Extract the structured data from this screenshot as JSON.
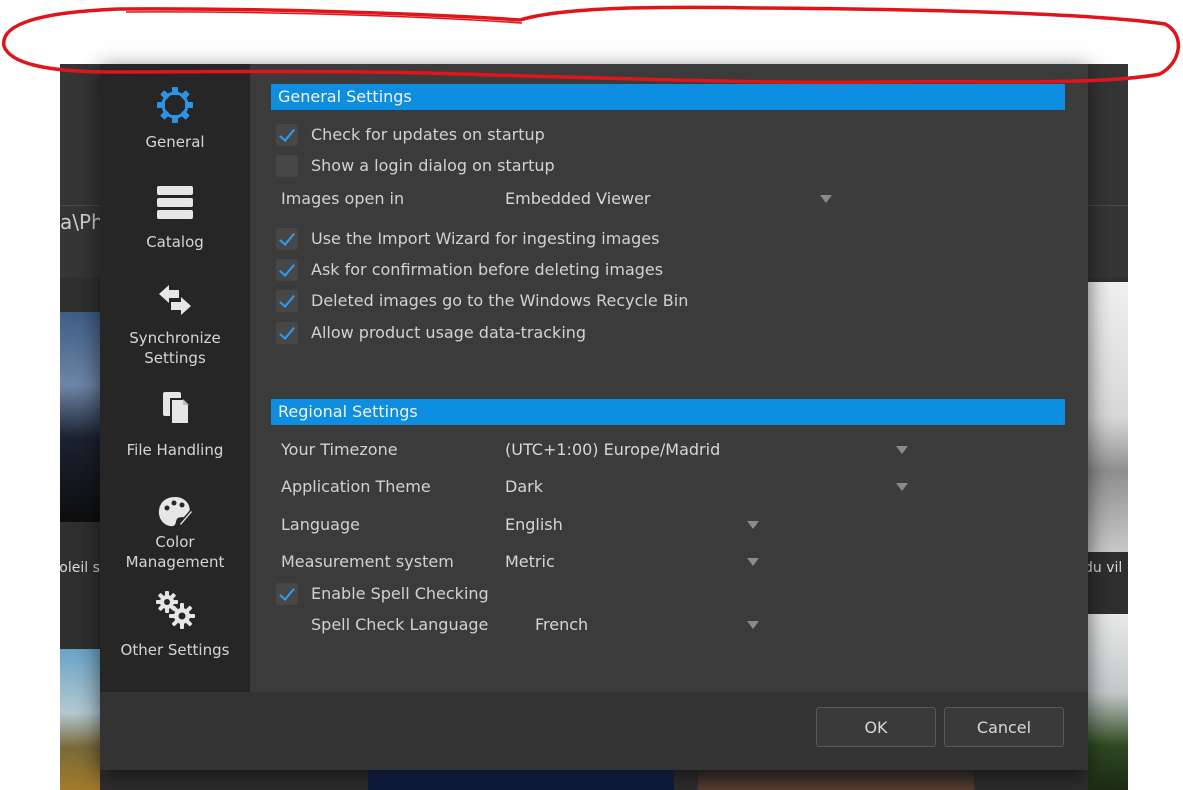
{
  "background": {
    "path_fragment": "a\\Ph",
    "caption_left": "soleil s",
    "caption_right": "du vil"
  },
  "sidebar": {
    "items": [
      {
        "label": "General",
        "icon": "gear-icon"
      },
      {
        "label": "Catalog",
        "icon": "stack-icon"
      },
      {
        "label": "Synchronize\nSettings",
        "icon": "sync-arrows-icon"
      },
      {
        "label": "File Handling",
        "icon": "documents-icon"
      },
      {
        "label": "Color\nManagement",
        "icon": "palette-icon"
      },
      {
        "label": "Other Settings",
        "icon": "gears-icon"
      }
    ]
  },
  "general": {
    "title": "General Settings",
    "check_updates": {
      "label": "Check for updates on startup",
      "checked": true
    },
    "login_dialog": {
      "label": "Show a login dialog on startup",
      "checked": false
    },
    "images_open_in": {
      "label": "Images open in",
      "value": "Embedded Viewer"
    },
    "import_wizard": {
      "label": "Use the Import Wizard for ingesting images",
      "checked": true
    },
    "confirm_delete": {
      "label": "Ask for confirmation before deleting images",
      "checked": true
    },
    "recycle_bin": {
      "label": "Deleted images go to the Windows Recycle Bin",
      "checked": true
    },
    "usage_tracking": {
      "label": "Allow product usage data-tracking",
      "checked": true
    }
  },
  "regional": {
    "title": "Regional Settings",
    "timezone": {
      "label": "Your Timezone",
      "value": "(UTC+1:00) Europe/Madrid"
    },
    "theme": {
      "label": "Application Theme",
      "value": "Dark"
    },
    "language": {
      "label": "Language",
      "value": "English"
    },
    "measurement": {
      "label": "Measurement system",
      "value": "Metric"
    },
    "spell_check": {
      "label": "Enable Spell Checking",
      "checked": true
    },
    "spell_language": {
      "label": "Spell Check Language",
      "value": "French"
    }
  },
  "buttons": {
    "ok": "OK",
    "cancel": "Cancel"
  },
  "colors": {
    "accent": "#0d8ee0",
    "annotation": "#e0141b",
    "dialog_bg": "#393939",
    "sidebar_bg": "#262626"
  }
}
